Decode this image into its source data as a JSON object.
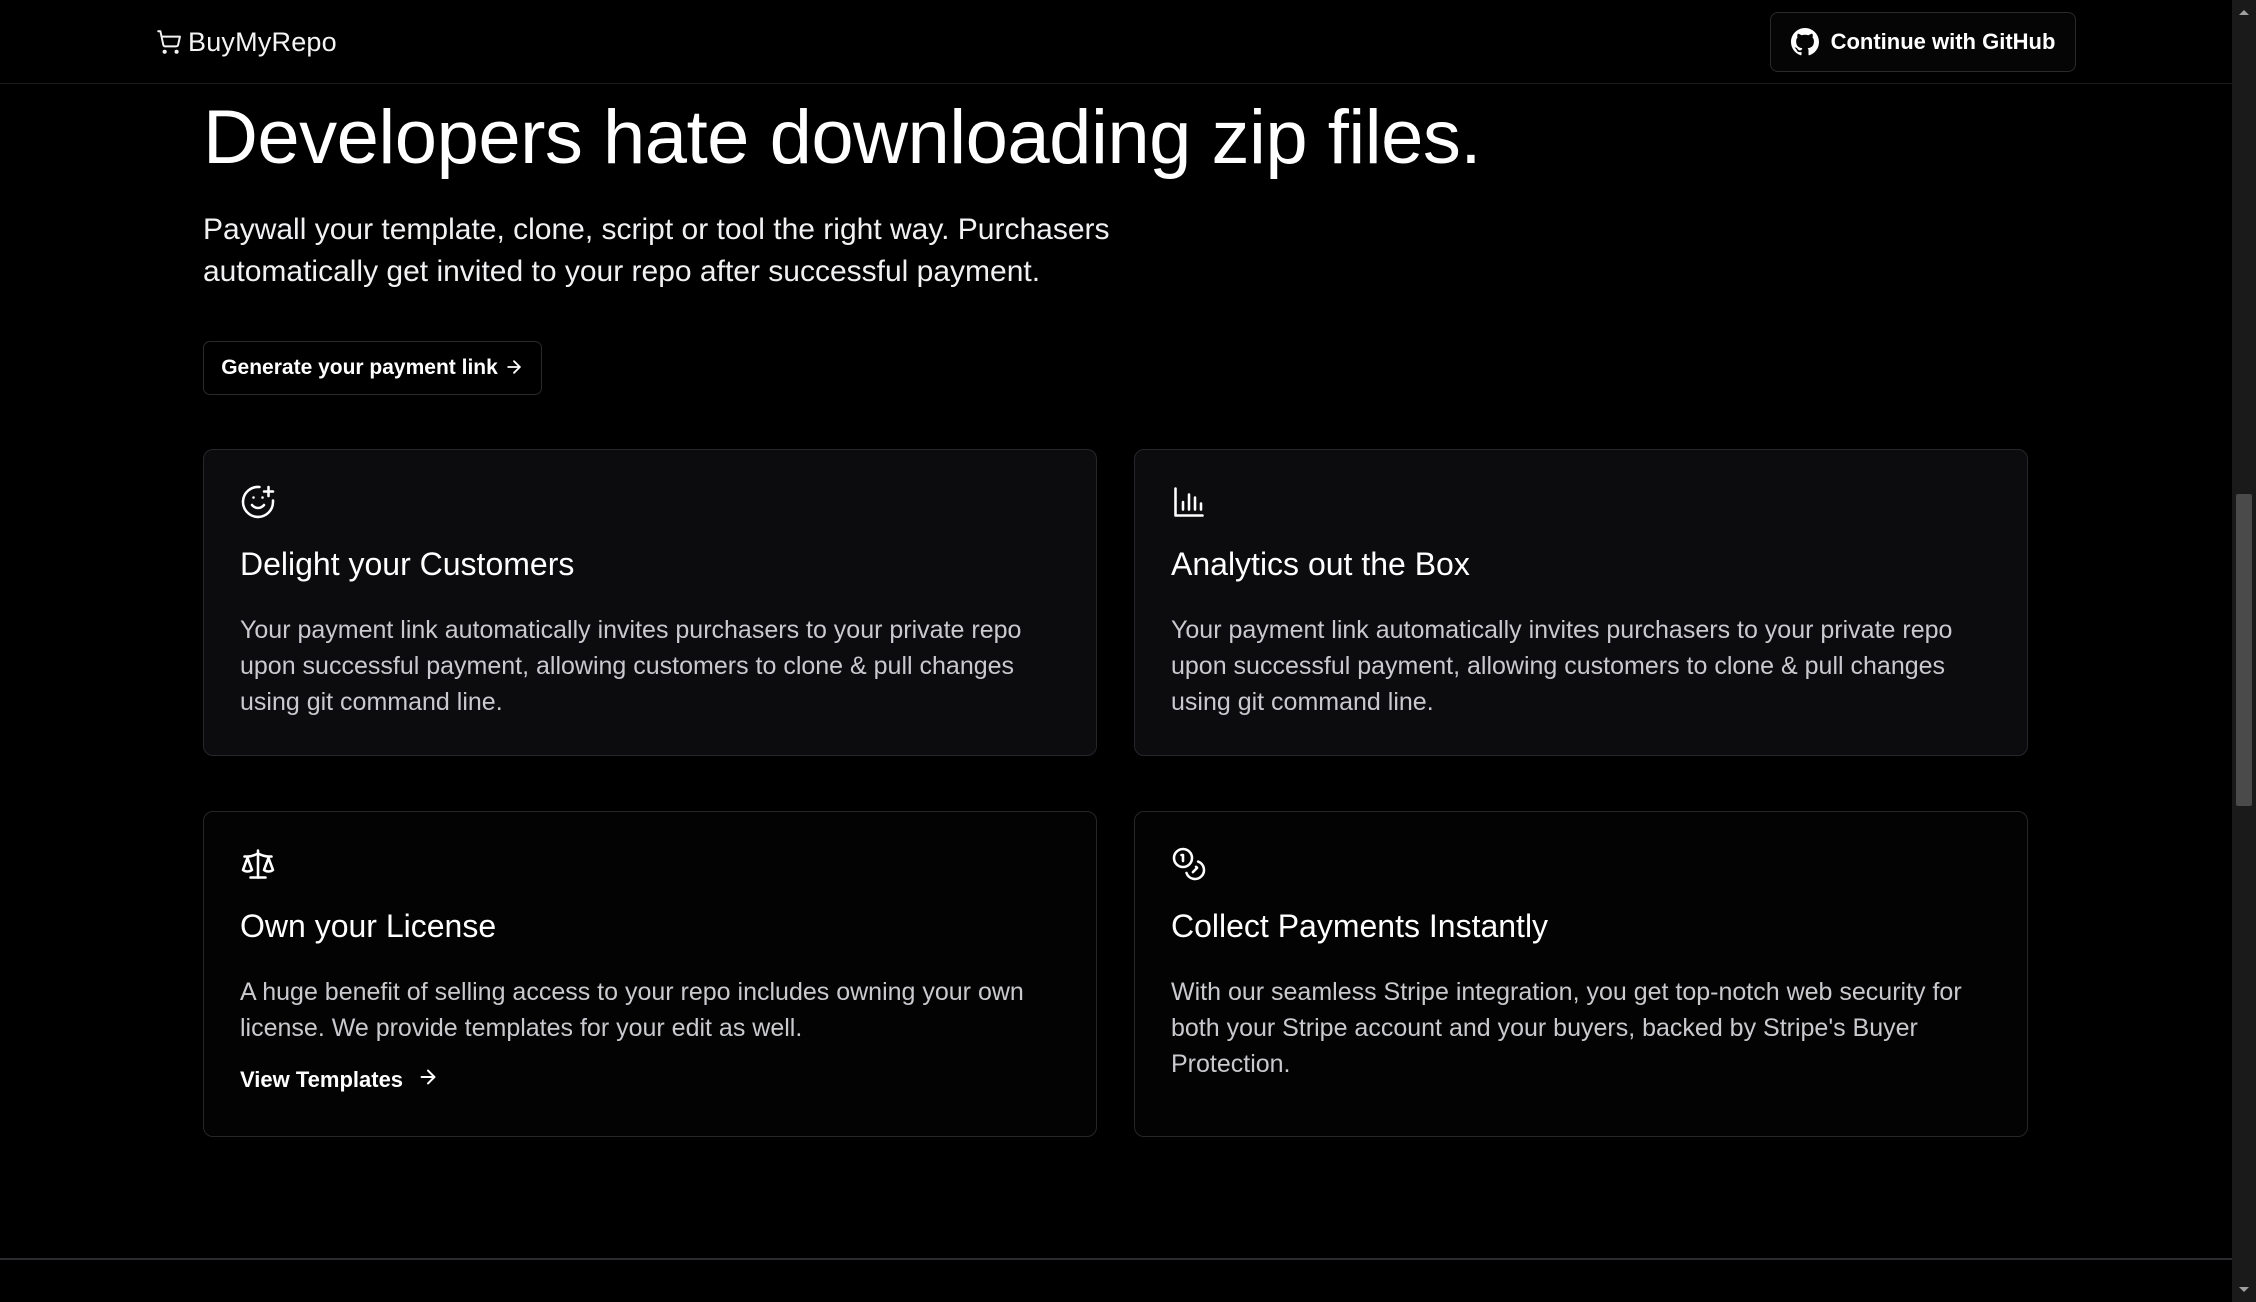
{
  "navbar": {
    "brand": "BuyMyRepo",
    "brand_icon": "cart-icon",
    "github_button": {
      "label": "Continue with GitHub",
      "icon": "github-icon"
    }
  },
  "hero": {
    "title": "Developers hate downloading zip files.",
    "subtitle": "Paywall your template, clone, script or tool the right way. Purchasers automatically get invited to your repo after successful payment.",
    "cta": {
      "label": "Generate your payment link",
      "icon": "arrow-right-icon"
    }
  },
  "features": [
    {
      "icon": "smile-plus-icon",
      "title": "Delight your Customers",
      "description": "Your payment link automatically invites purchasers to your private repo upon successful payment, allowing customers to clone & pull changes using git command line."
    },
    {
      "icon": "bar-chart-icon",
      "title": "Analytics out the Box",
      "description": "Your payment link automatically invites purchasers to your private repo upon successful payment, allowing customers to clone & pull changes using git command line."
    },
    {
      "icon": "scale-icon",
      "title": "Own your License",
      "description": "A huge benefit of selling access to your repo includes owning your own license. We provide templates for your edit as well.",
      "link": {
        "label": "View Templates",
        "icon": "arrow-right-icon"
      }
    },
    {
      "icon": "coins-icon",
      "title": "Collect Payments Instantly",
      "description": "With our seamless Stripe integration, you get top-notch web security for both your Stripe account and your buyers, backed by Stripe's Buyer Protection."
    }
  ],
  "colors": {
    "background": "#000000",
    "card_background": "#0c0c0e",
    "card_border": "#26262b",
    "text_primary": "#ffffff",
    "text_secondary": "#c9c9ce"
  }
}
